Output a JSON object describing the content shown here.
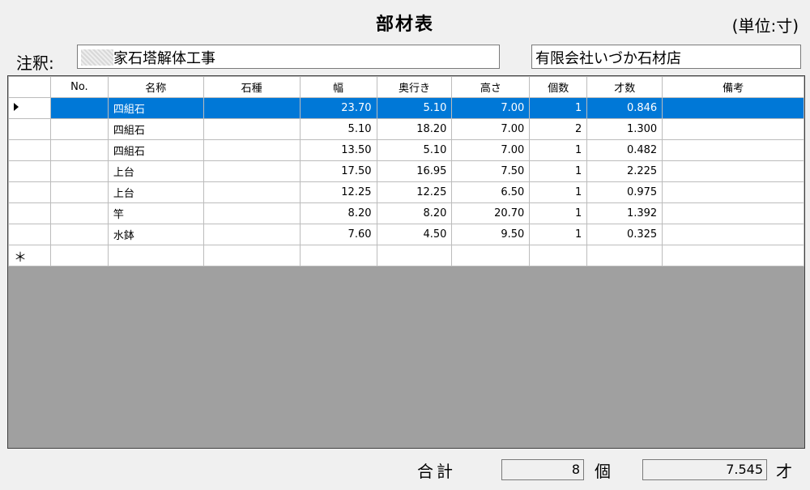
{
  "header": {
    "title": "部材表",
    "unit": "(単位:寸)"
  },
  "note": {
    "label": "注釈:",
    "value": "家石塔解体工事",
    "company": "有限会社いづか石材店"
  },
  "grid": {
    "columns": [
      "No.",
      "名称",
      "石種",
      "幅",
      "奥行き",
      "高さ",
      "個数",
      "才数",
      "備考"
    ],
    "rows": [
      {
        "no": "",
        "name": "四組石",
        "stone": "",
        "width": "23.70",
        "depth": "5.10",
        "height": "7.00",
        "count": "1",
        "saisu": "0.846",
        "remarks": ""
      },
      {
        "no": "",
        "name": "四組石",
        "stone": "",
        "width": "5.10",
        "depth": "18.20",
        "height": "7.00",
        "count": "2",
        "saisu": "1.300",
        "remarks": ""
      },
      {
        "no": "",
        "name": "四組石",
        "stone": "",
        "width": "13.50",
        "depth": "5.10",
        "height": "7.00",
        "count": "1",
        "saisu": "0.482",
        "remarks": ""
      },
      {
        "no": "",
        "name": "上台",
        "stone": "",
        "width": "17.50",
        "depth": "16.95",
        "height": "7.50",
        "count": "1",
        "saisu": "2.225",
        "remarks": ""
      },
      {
        "no": "",
        "name": "上台",
        "stone": "",
        "width": "12.25",
        "depth": "12.25",
        "height": "6.50",
        "count": "1",
        "saisu": "0.975",
        "remarks": ""
      },
      {
        "no": "",
        "name": "竿",
        "stone": "",
        "width": "8.20",
        "depth": "8.20",
        "height": "20.70",
        "count": "1",
        "saisu": "1.392",
        "remarks": ""
      },
      {
        "no": "",
        "name": "水鉢",
        "stone": "",
        "width": "7.60",
        "depth": "4.50",
        "height": "9.50",
        "count": "1",
        "saisu": "0.325",
        "remarks": ""
      }
    ],
    "new_row_marker": "＊"
  },
  "totals": {
    "label": "合計",
    "count": "8",
    "count_unit": "個",
    "saisu": "7.545",
    "saisu_unit": "才"
  },
  "colors": {
    "selection": "#0078d7",
    "background": "#f0f0f0",
    "grid_empty": "#a0a0a0"
  }
}
